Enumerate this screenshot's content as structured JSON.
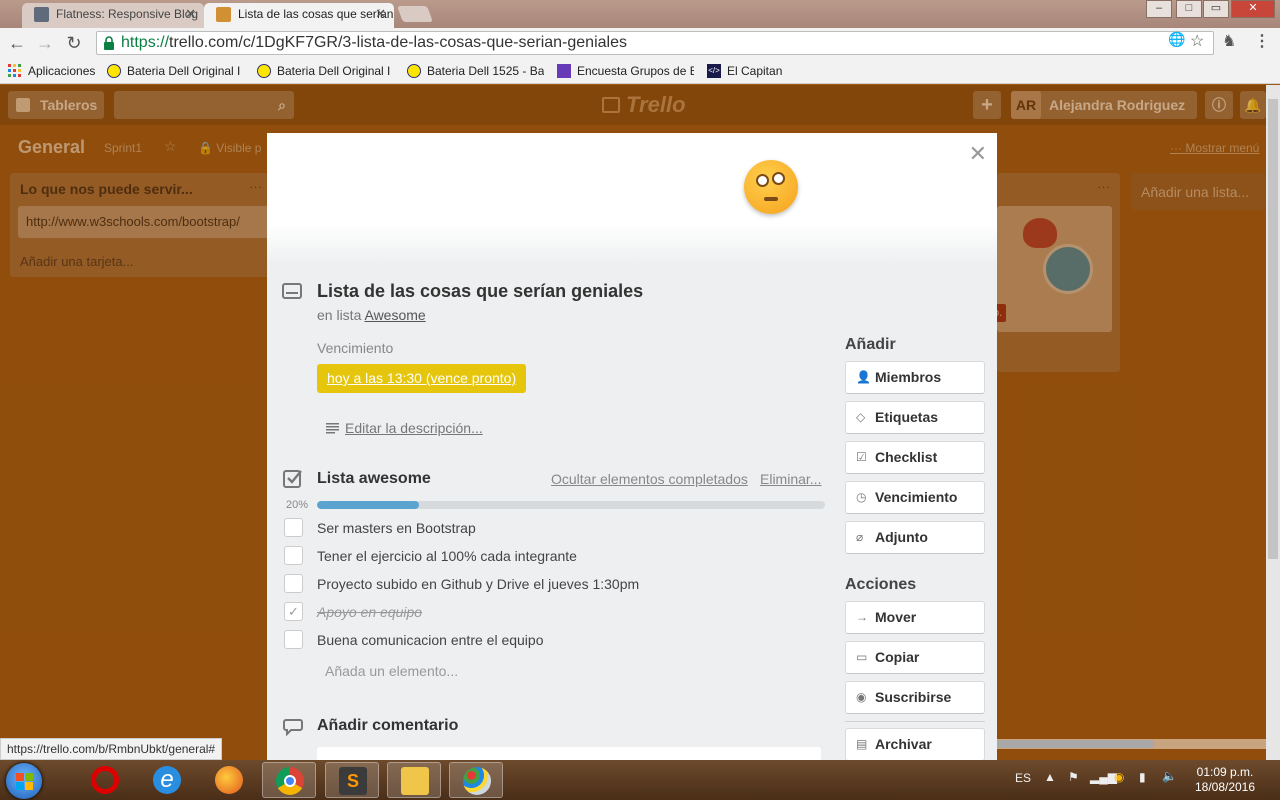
{
  "browser": {
    "tabs": [
      {
        "title": "Flatness: Responsive Blog"
      },
      {
        "title": "Lista de las cosas que serían"
      }
    ],
    "window_controls": {
      "minimize": "–",
      "maximize": "□",
      "close": "✕"
    },
    "url_scheme": "https://",
    "url_rest": "trello.com/c/1DgKF7GR/3-lista-de-las-cosas-que-serian-geniales",
    "bookmarks": [
      {
        "label": "Aplicaciones",
        "icon": "apps-grid-icon"
      },
      {
        "label": "Bateria Dell Original I",
        "icon": "ml-logo-icon"
      },
      {
        "label": "Bateria Dell Original I",
        "icon": "ml-logo-icon"
      },
      {
        "label": "Bateria Dell 1525 - Ba",
        "icon": "ml-logo-icon"
      },
      {
        "label": "Encuesta Grupos de E",
        "icon": "form-icon"
      },
      {
        "label": "El Capitan",
        "icon": "code-icon"
      }
    ],
    "status_url": "https://trello.com/b/RmbnUbkt/general#"
  },
  "board": {
    "boards_button": "Tableros",
    "logo": "Trello",
    "user_initials": "AR",
    "user_name": "Alejandra Rodriguez",
    "title": "General",
    "sprint": "Sprint1",
    "visibility": "Visible p",
    "show_menu": "Mostrar menú",
    "list1": {
      "title": "Lo que nos puede servir...",
      "card": "http://www.w3schools.com/bootstrap/",
      "add_card": "Añadir una tarjeta..."
    },
    "list_tag_fragment": "o.",
    "add_list": "Añadir una lista..."
  },
  "modal": {
    "title": "Lista de las cosas que serían geniales",
    "in_list_prefix": "en lista",
    "in_list_name": "Awesome",
    "due_label": "Vencimiento",
    "due_value": "hoy a las 13:30 (vence pronto)",
    "edit_description": "Editar la descripción...",
    "checklist": {
      "title": "Lista awesome",
      "hide_completed": "Ocultar elementos completados",
      "delete": "Eliminar...",
      "percent_label": "20%",
      "progress": 0.2,
      "items": [
        {
          "text": "Ser masters en Bootstrap",
          "done": false
        },
        {
          "text": "Tener el ejercicio al 100% cada integrante",
          "done": false
        },
        {
          "text": "Proyecto subido en Github y Drive el jueves 1:30pm",
          "done": false
        },
        {
          "text": "Apoyo en equipo",
          "done": true
        },
        {
          "text": "Buena comunicacion entre el equipo",
          "done": false
        }
      ],
      "add_item": "Añada un elemento..."
    },
    "add_comment": "Añadir comentario",
    "sidebar": {
      "add_heading": "Añadir",
      "add_buttons": [
        {
          "label": "Miembros",
          "icon": "person-icon"
        },
        {
          "label": "Etiquetas",
          "icon": "tag-icon"
        },
        {
          "label": "Checklist",
          "icon": "checkbox-icon"
        },
        {
          "label": "Vencimiento",
          "icon": "clock-icon"
        },
        {
          "label": "Adjunto",
          "icon": "paperclip-icon"
        }
      ],
      "actions_heading": "Acciones",
      "action_buttons": [
        {
          "label": "Mover",
          "icon": "arrow-right-icon"
        },
        {
          "label": "Copiar",
          "icon": "copy-icon"
        },
        {
          "label": "Suscribirse",
          "icon": "eye-icon"
        },
        {
          "label": "Archivar",
          "icon": "archive-icon"
        }
      ]
    }
  },
  "taskbar": {
    "language": "ES",
    "time": "01:09 p.m.",
    "date": "18/08/2016"
  },
  "colors": {
    "board_bg": "#a05a12",
    "due_soon": "#e6c60d",
    "progress_fill": "#5ba4cf",
    "url_secure": "#0b8043"
  }
}
